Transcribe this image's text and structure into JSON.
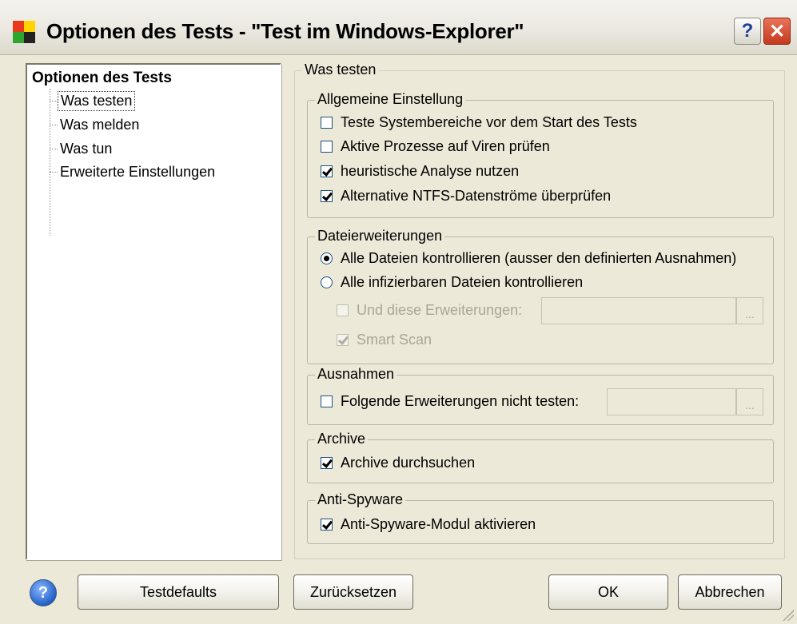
{
  "window": {
    "title": "Optionen des Tests - \"Test im Windows-Explorer\"",
    "help_glyph": "?",
    "close_glyph": "✕",
    "icon": "app-logo-icon"
  },
  "tree": {
    "root_label": "Optionen des Tests",
    "items": [
      {
        "label": "Was testen",
        "selected": true
      },
      {
        "label": "Was melden",
        "selected": false
      },
      {
        "label": "Was tun",
        "selected": false
      },
      {
        "label": "Erweiterte Einstellungen",
        "selected": false
      }
    ]
  },
  "panel": {
    "legend": "Was testen",
    "general": {
      "legend": "Allgemeine Einstellung",
      "options": [
        {
          "label": "Teste Systembereiche vor dem Start des Tests",
          "checked": false
        },
        {
          "label": "Aktive Prozesse auf Viren prüfen",
          "checked": false
        },
        {
          "label": "heuristische Analyse nutzen",
          "checked": true
        },
        {
          "label": "Alternative NTFS-Datenströme überprüfen",
          "checked": true
        }
      ]
    },
    "extensions": {
      "legend": "Dateierweiterungen",
      "radio_all": {
        "label": "Alle Dateien kontrollieren (ausser den definierten Ausnahmen)",
        "checked": true
      },
      "radio_infectable": {
        "label": "Alle infizierbaren Dateien kontrollieren",
        "checked": false
      },
      "and_these": {
        "label": "Und diese Erweiterungen:",
        "checked": false,
        "enabled": false,
        "value": ""
      },
      "smart_scan": {
        "label": "Smart Scan",
        "checked": true,
        "enabled": false
      },
      "browse_label": "..."
    },
    "exceptions": {
      "legend": "Ausnahmen",
      "option": {
        "label": "Folgende Erweiterungen nicht testen:",
        "checked": false,
        "value": ""
      },
      "browse_label": "..."
    },
    "archive": {
      "legend": "Archive",
      "option": {
        "label": "Archive durchsuchen",
        "checked": true
      }
    },
    "antispyware": {
      "legend": "Anti-Spyware",
      "option": {
        "label": "Anti-Spyware-Modul aktivieren",
        "checked": true
      }
    }
  },
  "buttons": {
    "help_glyph": "?",
    "testdefaults": "Testdefaults",
    "reset": "Zurücksetzen",
    "ok": "OK",
    "cancel": "Abbrechen"
  },
  "colors": {
    "face": "#ece9d8",
    "close_red": "#c43a1c",
    "help_blue": "#2360c8"
  }
}
